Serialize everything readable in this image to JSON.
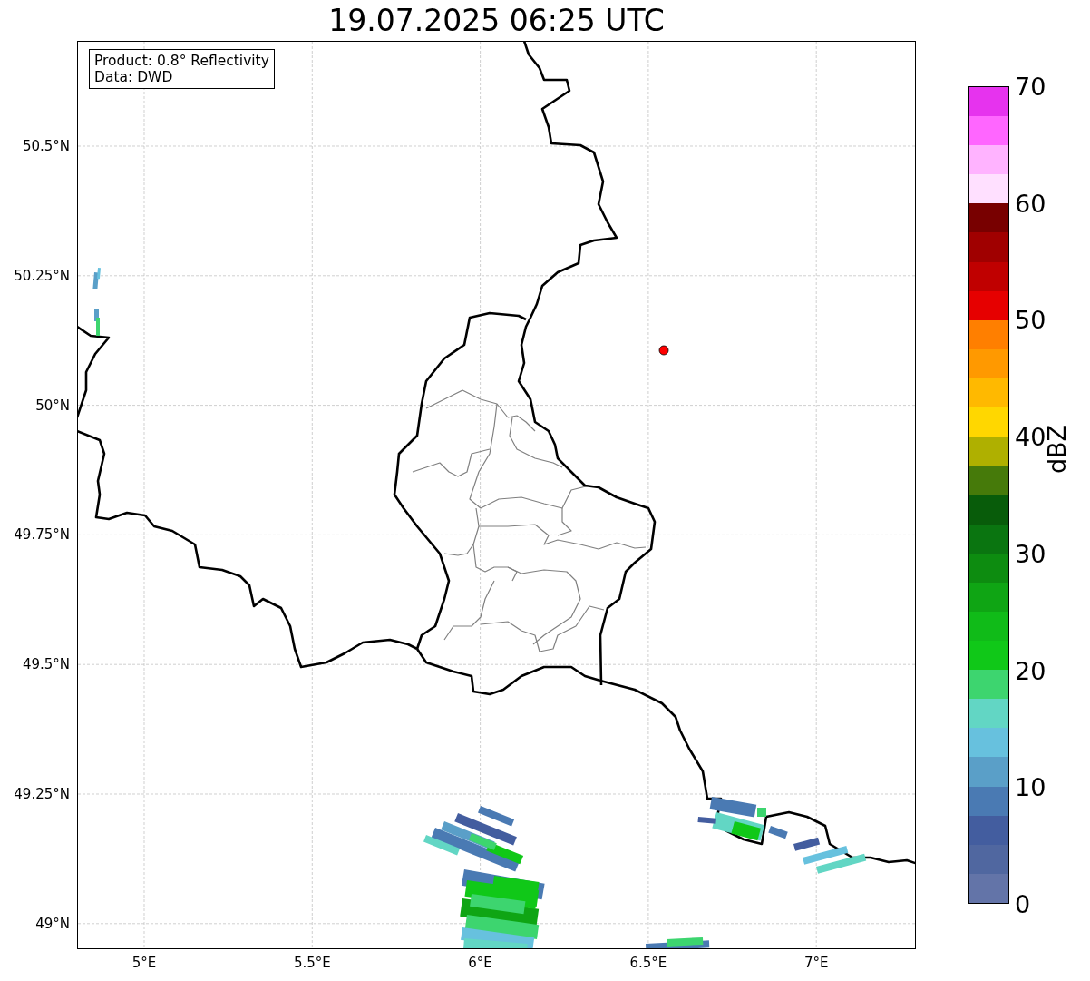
{
  "title": "19.07.2025 06:25 UTC",
  "info_box": {
    "lines": [
      "Product: 0.8° Reflectivity",
      "Data: DWD"
    ]
  },
  "map": {
    "x_ticks": [
      "5°E",
      "5.5°E",
      "6°E",
      "6.5°E",
      "7°E"
    ],
    "y_ticks": [
      "50.5°N",
      "50.25°N",
      "50°N",
      "49.75°N",
      "49.5°N",
      "49.25°N",
      "49°N"
    ]
  },
  "colorbar": {
    "label": "dBZ",
    "ticks": [
      "70",
      "60",
      "50",
      "40",
      "30",
      "20",
      "10",
      "0"
    ],
    "bins": [
      {
        "color": "#6374a8"
      },
      {
        "color": "#5067a0"
      },
      {
        "color": "#435d9f"
      },
      {
        "color": "#4a7ab3"
      },
      {
        "color": "#5a9fc8"
      },
      {
        "color": "#67c1de"
      },
      {
        "color": "#62d6c4"
      },
      {
        "color": "#3dd56f"
      },
      {
        "color": "#10c818"
      },
      {
        "color": "#10bb18"
      },
      {
        "color": "#0fa514"
      },
      {
        "color": "#0d8c10"
      },
      {
        "color": "#0a7510"
      },
      {
        "color": "#085c0a"
      },
      {
        "color": "#467a0a"
      },
      {
        "color": "#afb000"
      },
      {
        "color": "#ffd700"
      },
      {
        "color": "#ffb900"
      },
      {
        "color": "#ff9900"
      },
      {
        "color": "#ff7f00"
      },
      {
        "color": "#e60000"
      },
      {
        "color": "#c00000"
      },
      {
        "color": "#a00000"
      },
      {
        "color": "#780000"
      },
      {
        "color": "#ffe0ff"
      },
      {
        "color": "#ffb3ff"
      },
      {
        "color": "#ff66ff"
      },
      {
        "color": "#e633ee"
      }
    ]
  }
}
